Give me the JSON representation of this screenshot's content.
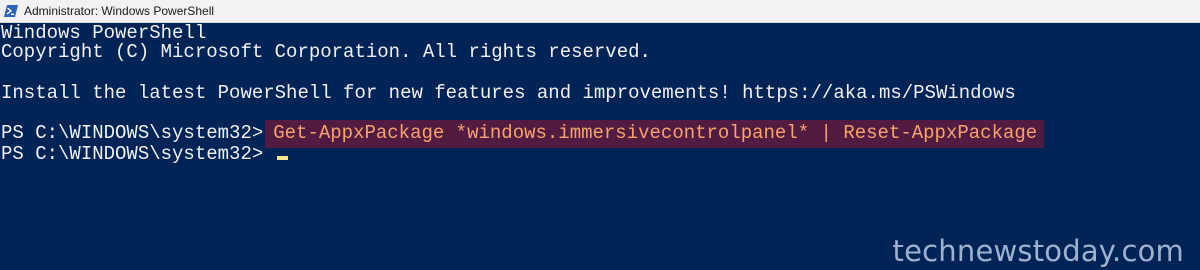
{
  "window": {
    "title": "Administrator: Windows PowerShell",
    "icon": "powershell-icon"
  },
  "console": {
    "banner_line_1": "Windows PowerShell",
    "banner_line_2": "Copyright (C) Microsoft Corporation. All rights reserved.",
    "install_message": "Install the latest PowerShell for new features and improvements! https://aka.ms/PSWindows",
    "prompt_1": "PS C:\\WINDOWS\\system32>",
    "command_1": "Get-AppxPackage *windows.immersivecontrolpanel* | Reset-AppxPackage",
    "prompt_2": "PS C:\\WINDOWS\\system32>"
  },
  "watermark": "technewstoday.com",
  "colors": {
    "console_background": "#012456",
    "console_text": "#f0f0f0",
    "command_highlight_background": "#521b41",
    "command_text": "#f8a36a",
    "cursor": "#f6e48a",
    "titlebar_background": "#f2f2f2"
  }
}
